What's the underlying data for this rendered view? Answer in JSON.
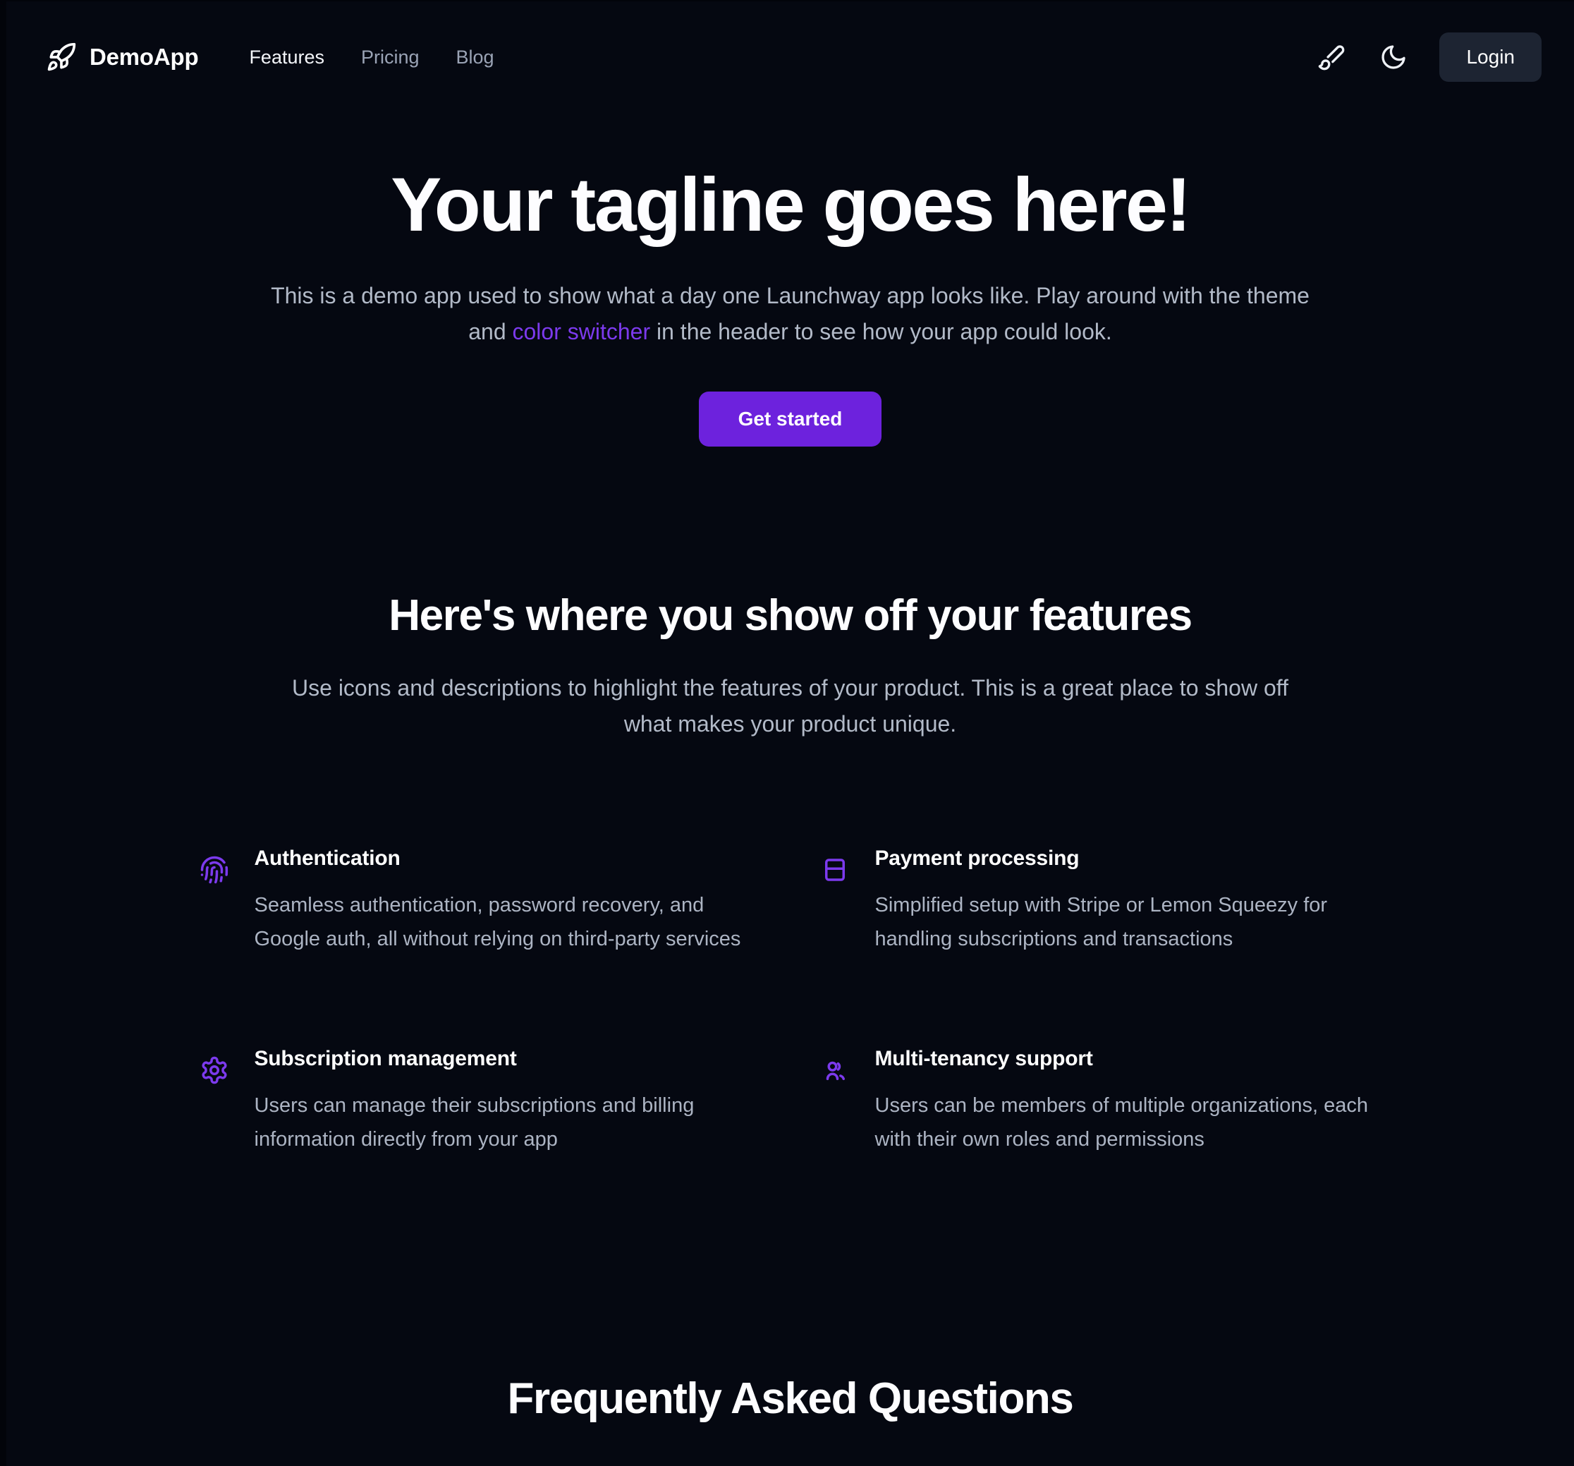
{
  "header": {
    "brand": {
      "logo_icon": "rocket-icon",
      "name": "DemoApp"
    },
    "nav": [
      {
        "label": "Features",
        "active": true
      },
      {
        "label": "Pricing",
        "active": false
      },
      {
        "label": "Blog",
        "active": false
      }
    ],
    "actions": {
      "theme_color_icon": "paintbrush-icon",
      "dark_mode_icon": "moon-icon",
      "login_label": "Login"
    }
  },
  "hero": {
    "title": "Your tagline goes here!",
    "sub_before": "This is a demo app used to show what a day one Launchway app looks like. Play around with the theme and ",
    "sub_link": "color switcher",
    "sub_after": " in the header to see how your app could look.",
    "cta_label": "Get started"
  },
  "features": {
    "title": "Here's where you show off your features",
    "subtitle": "Use icons and descriptions to highlight the features of your product. This is a great place to show off what makes your product unique.",
    "items": [
      {
        "icon": "fingerprint-icon",
        "title": "Authentication",
        "desc": "Seamless authentication, password recovery, and Google auth, all without relying on third-party services"
      },
      {
        "icon": "credit-card-icon",
        "title": "Payment processing",
        "desc": "Simplified setup with Stripe or Lemon Squeezy for handling subscriptions and transactions"
      },
      {
        "icon": "gear-icon",
        "title": "Subscription management",
        "desc": "Users can manage their subscriptions and billing information directly from your app"
      },
      {
        "icon": "users-icon",
        "title": "Multi-tenancy support",
        "desc": "Users can be members of multiple organizations, each with their own roles and permissions"
      }
    ]
  },
  "faq": {
    "title": "Frequently Asked Questions",
    "subtitle": ""
  },
  "colors": {
    "background": "#050811",
    "accent_purple": "#6d22dd",
    "link_purple": "#7c3aed",
    "icon_purple": "#7c3aed",
    "login_button_bg": "#1d2432",
    "heading_text": "#fdfdff",
    "body_text": "#b2bac8",
    "muted_nav_text": "#9aa3b5"
  }
}
